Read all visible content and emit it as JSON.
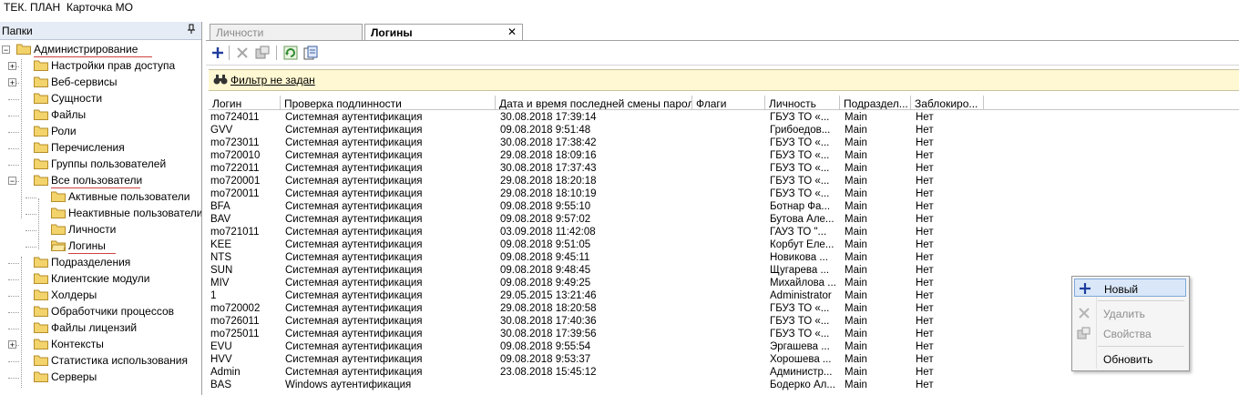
{
  "menu": {
    "items": [
      "ТЕК. ПЛАН",
      "Карточка МО"
    ]
  },
  "left_panel": {
    "title": "Папки",
    "pin_icon": "pin-icon",
    "tree": [
      {
        "label": "Администрирование",
        "expander": "−"
      },
      {
        "label": "Настройки прав доступа",
        "expander": "+"
      },
      {
        "label": "Веб-сервисы",
        "expander": "+"
      },
      {
        "label": "Сущности"
      },
      {
        "label": "Файлы"
      },
      {
        "label": "Роли"
      },
      {
        "label": "Перечисления"
      },
      {
        "label": "Группы пользователей"
      },
      {
        "label": "Все пользователи",
        "expander": "−"
      },
      {
        "label": "Активные пользователи"
      },
      {
        "label": "Неактивные пользователи"
      },
      {
        "label": "Личности"
      },
      {
        "label": "Логины"
      },
      {
        "label": "Подразделения"
      },
      {
        "label": "Клиентские модули"
      },
      {
        "label": "Холдеры"
      },
      {
        "label": "Обработчики процессов"
      },
      {
        "label": "Файлы лицензий"
      },
      {
        "label": "Контексты",
        "expander": "+"
      },
      {
        "label": "Статистика использования"
      },
      {
        "label": "Серверы"
      }
    ]
  },
  "tabs": [
    {
      "label": "Личности",
      "active": false
    },
    {
      "label": "Логины",
      "active": true,
      "close": "✕"
    }
  ],
  "toolbar": {
    "buttons": [
      "add-icon",
      "delete-icon",
      "properties-icon",
      "refresh-icon",
      "export-icon"
    ]
  },
  "filter": {
    "text": "Фильтр не задан",
    "icon": "binoculars-icon"
  },
  "grid": {
    "columns": [
      "Логин",
      "Проверка подлинности",
      "Дата и время последней смены пароля",
      "Флаги",
      "Личность",
      "Подраздел...",
      "Заблокиро..."
    ],
    "rows": [
      [
        "mo724011",
        "Системная аутентификация",
        "30.08.2018 17:39:14",
        "",
        "ГБУЗ ТО «...",
        "Main",
        "Нет"
      ],
      [
        "GVV",
        "Системная аутентификация",
        "09.08.2018 9:51:48",
        "",
        "Грибоедов...",
        "Main",
        "Нет"
      ],
      [
        "mo723011",
        "Системная аутентификация",
        "30.08.2018 17:38:42",
        "",
        "ГБУЗ ТО «...",
        "Main",
        "Нет"
      ],
      [
        "mo720010",
        "Системная аутентификация",
        "29.08.2018 18:09:16",
        "",
        "ГБУЗ ТО «...",
        "Main",
        "Нет"
      ],
      [
        "mo722011",
        "Системная аутентификация",
        "30.08.2018 17:37:43",
        "",
        "ГБУЗ ТО «...",
        "Main",
        "Нет"
      ],
      [
        "mo720001",
        "Системная аутентификация",
        "29.08.2018 18:20:18",
        "",
        "ГБУЗ ТО «...",
        "Main",
        "Нет"
      ],
      [
        "mo720011",
        "Системная аутентификация",
        "29.08.2018 18:10:19",
        "",
        "ГБУЗ ТО «...",
        "Main",
        "Нет"
      ],
      [
        "BFA",
        "Системная аутентификация",
        "09.08.2018 9:55:10",
        "",
        "Ботнар Фа...",
        "Main",
        "Нет"
      ],
      [
        "BAV",
        "Системная аутентификация",
        "09.08.2018 9:57:02",
        "",
        "Бутова Але...",
        "Main",
        "Нет"
      ],
      [
        "mo721011",
        "Системная аутентификация",
        "03.09.2018 11:42:08",
        "",
        "ГАУЗ ТО \"...",
        "Main",
        "Нет"
      ],
      [
        "KEE",
        "Системная аутентификация",
        "09.08.2018 9:51:05",
        "",
        "Корбут Еле...",
        "Main",
        "Нет"
      ],
      [
        "NTS",
        "Системная аутентификация",
        "09.08.2018 9:45:11",
        "",
        "Новикова ...",
        "Main",
        "Нет"
      ],
      [
        "SUN",
        "Системная аутентификация",
        "09.08.2018 9:48:45",
        "",
        "Щугарева ...",
        "Main",
        "Нет"
      ],
      [
        "MIV",
        "Системная аутентификация",
        "09.08.2018 9:49:25",
        "",
        "Михайлова ...",
        "Main",
        "Нет"
      ],
      [
        "1",
        "Системная аутентификация",
        "29.05.2015 13:21:46",
        "",
        "Administrator",
        "Main",
        "Нет"
      ],
      [
        "mo720002",
        "Системная аутентификация",
        "29.08.2018 18:20:58",
        "",
        "ГБУЗ ТО «...",
        "Main",
        "Нет"
      ],
      [
        "mo726011",
        "Системная аутентификация",
        "30.08.2018 17:40:36",
        "",
        "ГБУЗ ТО «...",
        "Main",
        "Нет"
      ],
      [
        "mo725011",
        "Системная аутентификация",
        "30.08.2018 17:39:56",
        "",
        "ГБУЗ ТО «...",
        "Main",
        "Нет"
      ],
      [
        "EVU",
        "Системная аутентификация",
        "09.08.2018 9:55:54",
        "",
        "Эргашева ...",
        "Main",
        "Нет"
      ],
      [
        "HVV",
        "Системная аутентификация",
        "09.08.2018 9:53:37",
        "",
        "Хорошева ...",
        "Main",
        "Нет"
      ],
      [
        "Admin",
        "Системная аутентификация",
        "23.08.2018 15:45:12",
        "",
        "Администр...",
        "Main",
        "Нет"
      ],
      [
        "BAS",
        "Windows аутентификация",
        "",
        "",
        "Бодерко Ал...",
        "Main",
        "Нет"
      ]
    ]
  },
  "context_menu": {
    "items": [
      {
        "label": "Новый",
        "icon": "plus-icon",
        "state": "highlighted"
      },
      {
        "label": "Удалить",
        "icon": "delete-icon",
        "state": "disabled"
      },
      {
        "label": "Свойства",
        "icon": "properties-icon",
        "state": "disabled"
      },
      {
        "label": "Обновить",
        "icon": "",
        "state": "normal"
      }
    ]
  },
  "colors": {
    "accent_blue": "#1f5fbf",
    "filter_bg": "#fff8d2",
    "underline_red": "#d04040",
    "folder": "#f3d36b"
  }
}
